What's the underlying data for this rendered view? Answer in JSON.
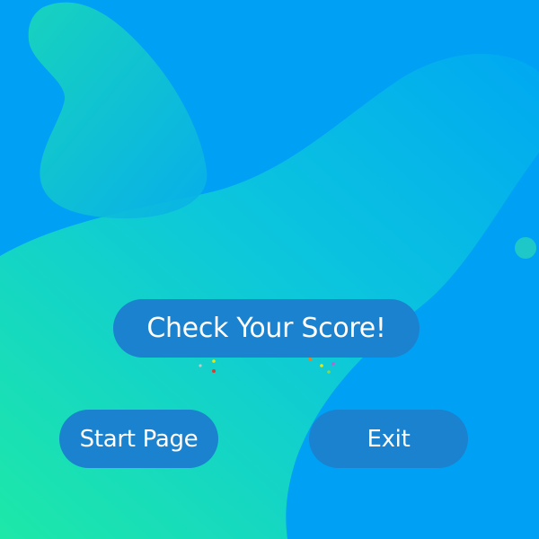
{
  "buttons": {
    "check_score": "Check Your Score!",
    "start_page": "Start Page",
    "exit": "Exit"
  },
  "colors": {
    "background": "#00a0f5",
    "button": "#1a82cf",
    "blob_green": "#1ee8a8",
    "text": "#ffffff"
  },
  "icons": {
    "confetti_left": "confetti-sparkles",
    "confetti_right": "confetti-sparkles"
  }
}
